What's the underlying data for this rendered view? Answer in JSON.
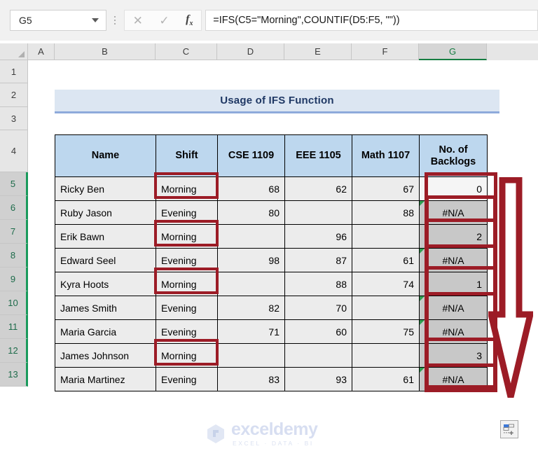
{
  "formula_bar": {
    "name_box_value": "G5",
    "cancel_icon": "close-icon",
    "accept_icon": "check-icon",
    "function_icon": "fx",
    "function_icon_sub": "x",
    "formula": "=IFS(C5=\"Morning\",COUNTIF(D5:F5, \"\"))"
  },
  "grid": {
    "columns": [
      "A",
      "B",
      "C",
      "D",
      "E",
      "F",
      "G"
    ],
    "active_column": "G",
    "rows": [
      "1",
      "2",
      "3",
      "4",
      "5",
      "6",
      "7",
      "8",
      "9",
      "10",
      "11",
      "12",
      "13"
    ],
    "selected_rows": [
      "5",
      "6",
      "7",
      "8",
      "9",
      "10",
      "11",
      "12",
      "13"
    ]
  },
  "title_banner": {
    "text": "Usage of IFS Function"
  },
  "table": {
    "headers": [
      "Name",
      "Shift",
      "CSE 1109",
      "EEE 1105",
      "Math 1107",
      "No. of\nBacklogs"
    ],
    "header_backlogs_line1": "No. of",
    "header_backlogs_line2": "Backlogs",
    "rows": [
      {
        "name": "Ricky Ben",
        "shift": "Morning",
        "cse": "68",
        "eee": "62",
        "math": "67",
        "backlogs": "0",
        "highlight_shift": true,
        "error": false,
        "active": true
      },
      {
        "name": "Ruby Jason",
        "shift": "Evening",
        "cse": "80",
        "eee": "",
        "math": "88",
        "backlogs": "#N/A",
        "highlight_shift": false,
        "error": true,
        "active": false
      },
      {
        "name": "Erik Bawn",
        "shift": "Morning",
        "cse": "",
        "eee": "96",
        "math": "",
        "backlogs": "2",
        "highlight_shift": true,
        "error": false,
        "active": false
      },
      {
        "name": "Edward Seel",
        "shift": "Evening",
        "cse": "98",
        "eee": "87",
        "math": "61",
        "backlogs": "#N/A",
        "highlight_shift": false,
        "error": true,
        "active": false
      },
      {
        "name": "Kyra Hoots",
        "shift": "Morning",
        "cse": "",
        "eee": "88",
        "math": "74",
        "backlogs": "1",
        "highlight_shift": true,
        "error": false,
        "active": false
      },
      {
        "name": "James Smith",
        "shift": "Evening",
        "cse": "82",
        "eee": "70",
        "math": "",
        "backlogs": "#N/A",
        "highlight_shift": false,
        "error": true,
        "active": false
      },
      {
        "name": "Maria Garcia",
        "shift": "Evening",
        "cse": "71",
        "eee": "60",
        "math": "75",
        "backlogs": "#N/A",
        "highlight_shift": false,
        "error": true,
        "active": false
      },
      {
        "name": "James Johnson",
        "shift": "Morning",
        "cse": "",
        "eee": "",
        "math": "",
        "backlogs": "3",
        "highlight_shift": true,
        "error": false,
        "active": false
      },
      {
        "name": "Maria Martinez",
        "shift": "Evening",
        "cse": "83",
        "eee": "93",
        "math": "61",
        "backlogs": "#N/A",
        "highlight_shift": false,
        "error": true,
        "active": false
      }
    ]
  },
  "annotation": {
    "arrow_icon": "down-arrow-icon",
    "arrow_color": "#9c1c26",
    "highlight_color": "#9c1c26"
  },
  "watermark": {
    "title": "exceldemy",
    "subtitle": "EXCEL · DATA · BI"
  },
  "autofill": {
    "icon": "autofill-options-icon"
  },
  "colors": {
    "header_fill": "#bdd7ee",
    "banner_fill": "#dce6f2",
    "banner_text": "#1f3864",
    "cell_fill": "#ececec",
    "result_fill": "#c8c8c8",
    "accent_red": "#9c1c26",
    "selection_green": "#167d42"
  }
}
